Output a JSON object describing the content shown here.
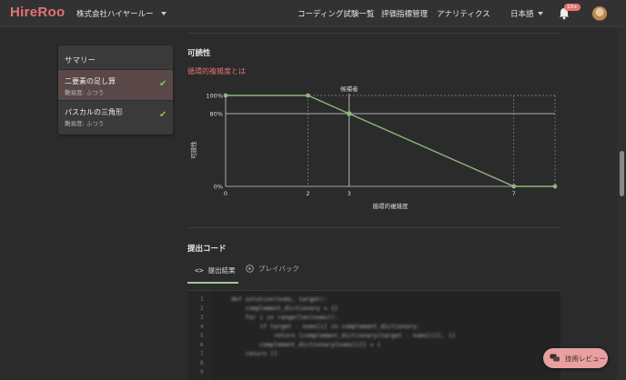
{
  "header": {
    "logo": "HireRoo",
    "company": "株式会社ハイヤールー",
    "nav": [
      "コーディング試験一覧",
      "評価指標管理",
      "アナリティクス"
    ],
    "lang": "日本語",
    "notification_count": "10+"
  },
  "sidebar": {
    "title": "サマリー",
    "items": [
      {
        "name": "二要素の足し算",
        "difficulty": "難易度: ふつう",
        "done": true
      },
      {
        "name": "パスカルの三角形",
        "difficulty": "難易度: ふつう",
        "done": true
      }
    ]
  },
  "readability": {
    "title": "可読性",
    "link": "循環的複雑度とは"
  },
  "chart_data": {
    "type": "line",
    "title": "候補者",
    "xlabel": "循環的複雑度",
    "ylabel": "可読性",
    "x": [
      0,
      2,
      7,
      8
    ],
    "y": [
      100,
      100,
      0,
      0
    ],
    "x_ticks": [
      0,
      2,
      3,
      7
    ],
    "y_ticks": [
      "0%",
      "80%",
      "100%"
    ],
    "xlim": [
      0,
      8
    ],
    "ylim": [
      0,
      100
    ],
    "candidate": {
      "x": 3,
      "y": 80
    },
    "line_color": "#8fb57f"
  },
  "submission": {
    "title": "提出コード",
    "tabs": [
      "提出結果",
      "プレイバック"
    ]
  },
  "code": {
    "line_numbers": [
      "1",
      "2",
      "3",
      "4",
      "5",
      "6",
      "7",
      "8",
      "9"
    ],
    "lines": [
      "def solution(nums, target):",
      "    complement_dictionary = {}",
      "    for i in range(len(nums)):",
      "        if target - nums[i] in complement_dictionary:",
      "            return [complement_dictionary[target - nums[i]], i]",
      "        complement_dictionary[nums[i]] = i",
      "    return []",
      "",
      ""
    ]
  },
  "review_button": "技術レビュー"
}
